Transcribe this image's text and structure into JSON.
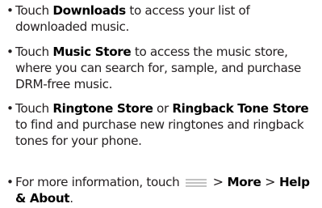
{
  "bullets": [
    {
      "parts": [
        "Touch ",
        "Downloads",
        " to access your list of downloaded music."
      ]
    },
    {
      "parts": [
        "Touch ",
        "Music Store",
        " to access the music store, where you can search for, sample, and purchase DRM-free music."
      ]
    },
    {
      "parts": [
        "Touch ",
        "Ringtone Store",
        " or ",
        "Ringback Tone Store",
        " to find and purchase new ringtones and ringback tones for your phone."
      ]
    },
    {
      "lead": "For more information, touch ",
      "icon": "menu-lines-icon",
      "sep1": " > ",
      "kw1": "More",
      "sep2": " > ",
      "kw2": "Help & About",
      "tail": "."
    }
  ],
  "bullet_symbol": "•",
  "colors": {
    "text": "#231f20",
    "icon": "#c2c2c2"
  }
}
